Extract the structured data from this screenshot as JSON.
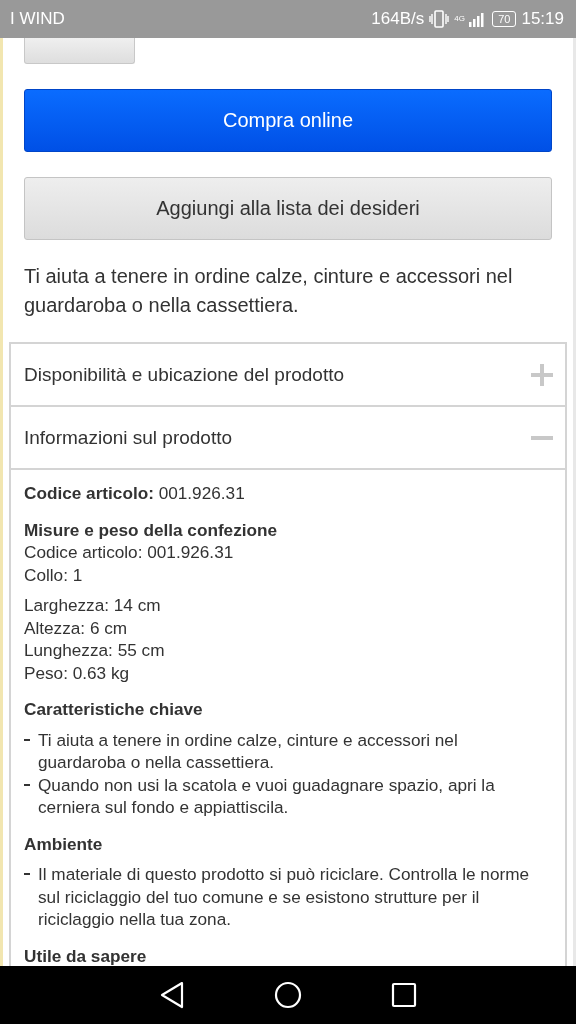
{
  "status_bar": {
    "carrier": "I WIND",
    "speed": "164B/s",
    "network": "4G",
    "battery": "70",
    "time": "15:19"
  },
  "buttons": [
    {
      "kind": "primary",
      "label": "Compra online"
    },
    {
      "kind": "secondary",
      "label": "Aggiungi alla lista dei desideri"
    }
  ],
  "summary": "Ti aiuta a tenere in ordine calze, cinture e accessori nel guardaroba o nella cassettiera.",
  "accordion": [
    {
      "title": "Disponibilità e ubicazione del prodotto",
      "expanded": false
    },
    {
      "title": "Informazioni sul prodotto",
      "expanded": true
    }
  ],
  "details": [
    {
      "kind": "line",
      "text": "**Codice articolo:** 001.926.31"
    },
    {
      "kind": "groups",
      "title": "Misure e peso della confezione",
      "groups": [
        [
          "Codice articolo: 001.926.31",
          "Collo: 1"
        ],
        [
          "Larghezza: 14 cm",
          "Altezza: 6 cm",
          "Lunghezza: 55 cm",
          "Peso: 0.63 kg"
        ]
      ]
    },
    {
      "kind": "bullets",
      "title": "Caratteristiche chiave",
      "items": [
        "Ti aiuta a tenere in ordine calze, cinture e accessori nel guardaroba o nella cassettiera.",
        "Quando non usi la scatola e vuoi guadagnare spazio, apri la cerniera sul fondo e appiattiscila."
      ]
    },
    {
      "kind": "bullets",
      "title": "Ambiente",
      "items": [
        "Il materiale di questo prodotto si può riciclare. Controlla le norme sul riciclaggio del tuo comune e se esistono strutture per il riciclaggio nella tua zona."
      ]
    },
    {
      "kind": "heading",
      "title": "Utile da sapere"
    }
  ]
}
